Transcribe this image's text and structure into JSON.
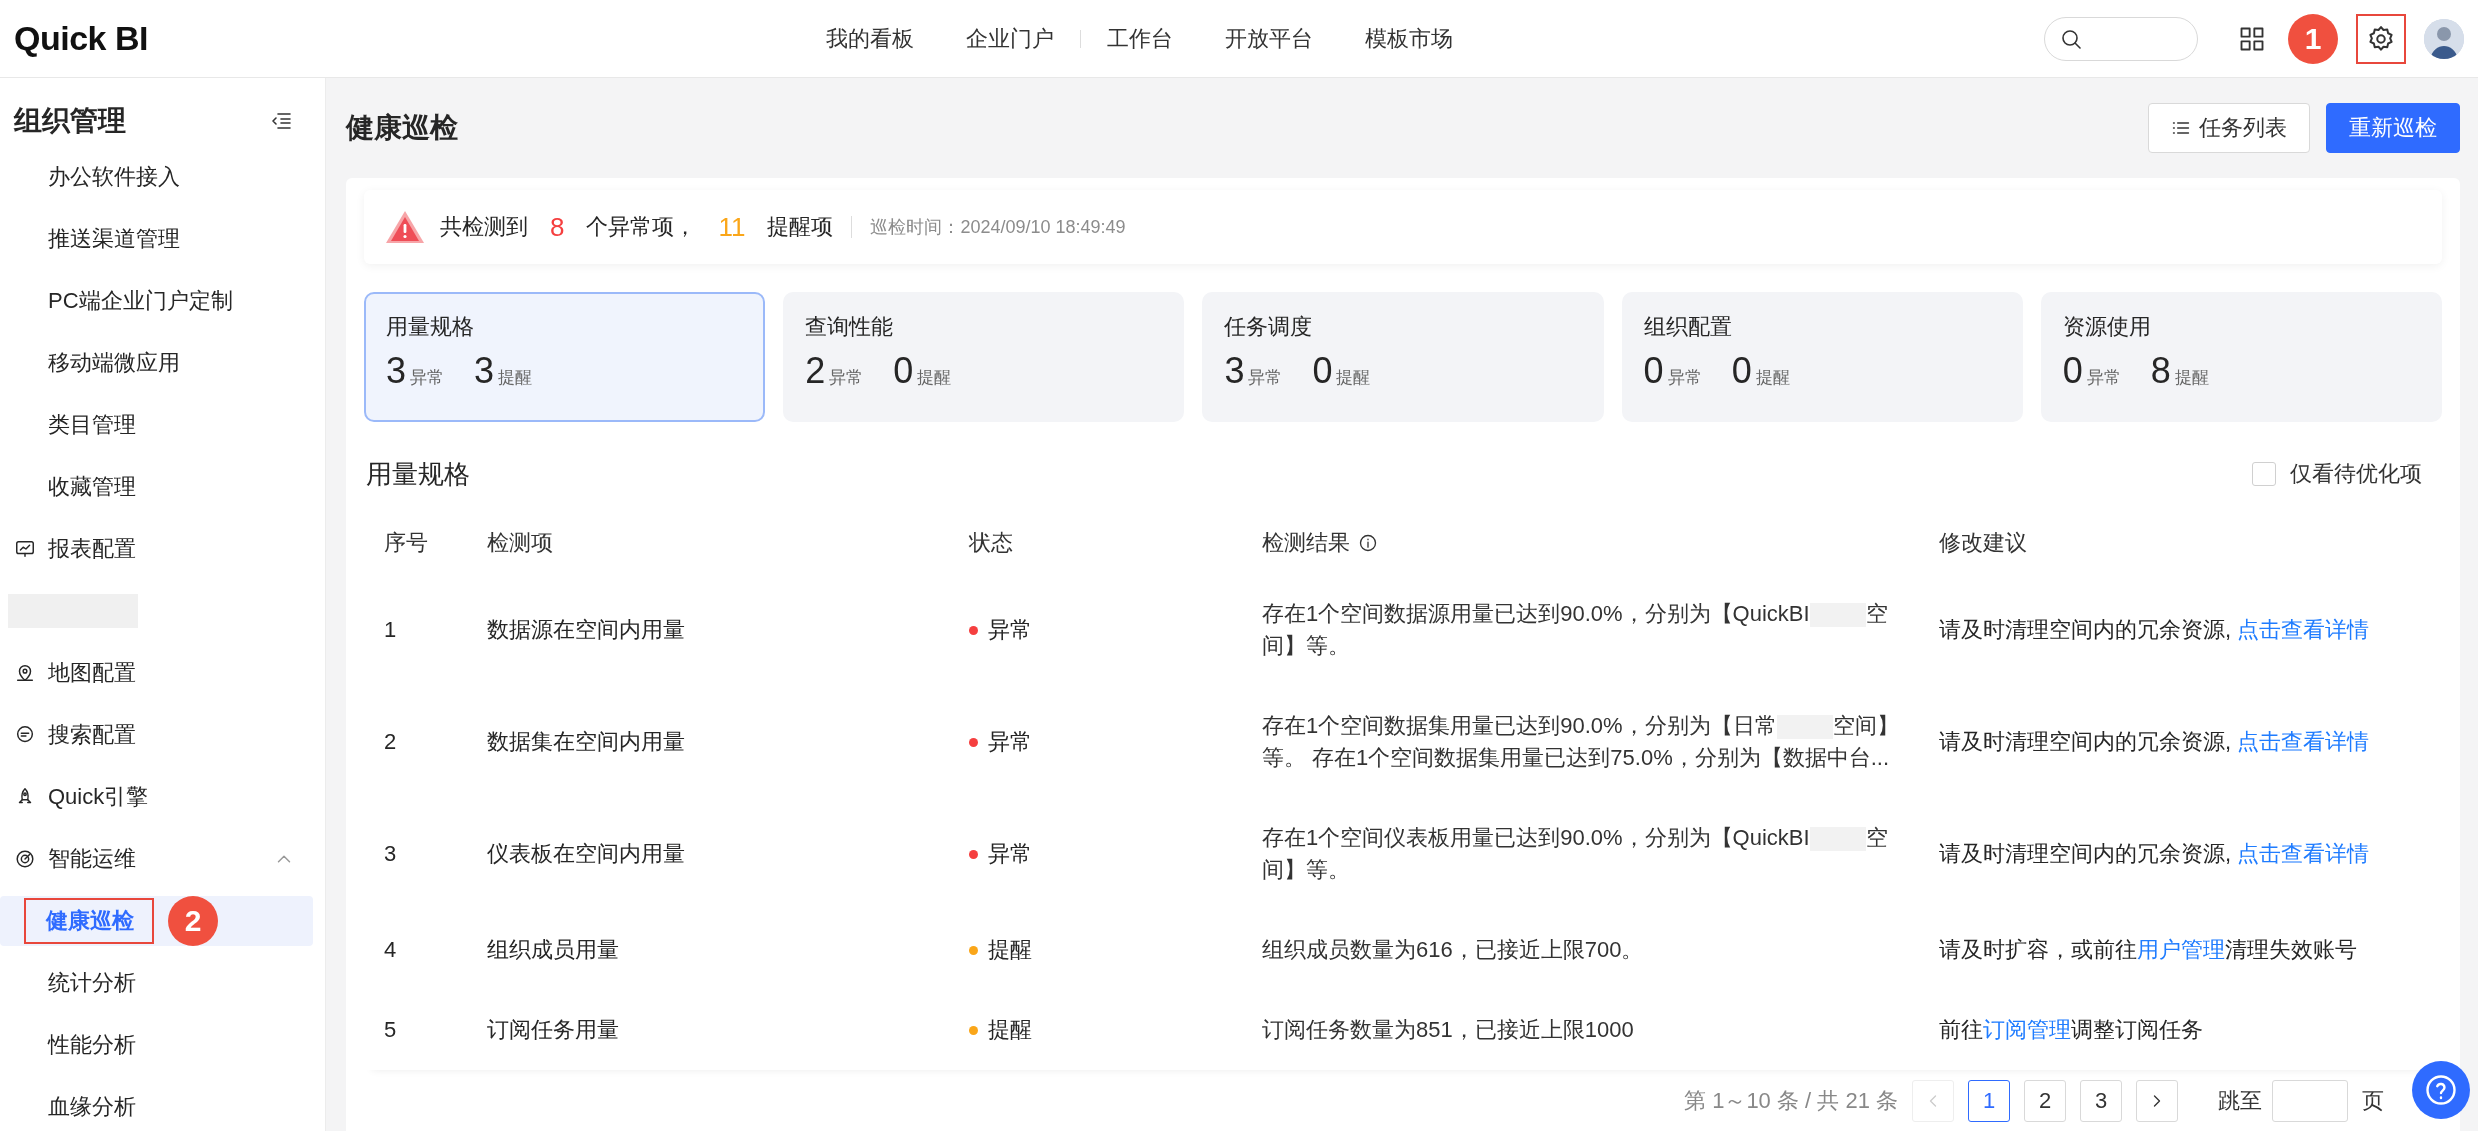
{
  "top_bar": {
    "logo": "Quick BI",
    "nav": [
      {
        "label": "我的看板"
      },
      {
        "label": "企业门户"
      },
      {
        "label": "工作台"
      },
      {
        "label": "开放平台"
      },
      {
        "label": "模板市场"
      }
    ],
    "settings_highlighted": true,
    "callout": "1"
  },
  "sidebar": {
    "sections": [
      {
        "kind": "header",
        "label": "组织管理",
        "children": [
          {
            "label": "办公软件接入",
            "selected": false,
            "highlighted": false
          },
          {
            "label": "推送渠道管理",
            "selected": false,
            "highlighted": false
          },
          {
            "label": "PC端企业门户定制",
            "selected": false,
            "highlighted": false
          },
          {
            "label": "移动端微应用",
            "selected": false,
            "highlighted": false
          },
          {
            "label": "类目管理",
            "selected": false,
            "highlighted": false
          },
          {
            "label": "收藏管理",
            "selected": false,
            "highlighted": false
          }
        ]
      },
      {
        "kind": "group",
        "label": "报表配置"
      },
      {
        "kind": "redacted"
      },
      {
        "kind": "group",
        "label": "地图配置"
      },
      {
        "kind": "group",
        "label": "搜索配置"
      },
      {
        "kind": "group",
        "label": "Quick引擎"
      },
      {
        "kind": "group",
        "label": "智能运维",
        "expanded": true,
        "children": [
          {
            "label": "健康巡检",
            "selected": true,
            "highlighted": true,
            "callout": "2"
          },
          {
            "label": "统计分析",
            "selected": false,
            "highlighted": false
          },
          {
            "label": "性能分析",
            "selected": false,
            "highlighted": false
          },
          {
            "label": "血缘分析",
            "selected": false,
            "highlighted": false
          }
        ]
      }
    ]
  },
  "page_header": {
    "title": "健康巡检",
    "buttons": [
      {
        "label": "任务列表",
        "kind": "secondary"
      },
      {
        "label": "重新巡检",
        "kind": "primary"
      }
    ]
  },
  "summary": {
    "prefix": "共检测到",
    "abnormal_count": "8",
    "abnormal_label": "个异常项，",
    "reminder_count": "11",
    "reminder_label": "提醒项",
    "time": "巡检时间：2024/09/10 18:49:49"
  },
  "categories": [
    {
      "title": "用量规格",
      "abnormal": "3",
      "abnormal_label": "异常",
      "reminder": "3",
      "reminder_label": "提醒",
      "selected": true
    },
    {
      "title": "查询性能",
      "abnormal": "2",
      "abnormal_label": "异常",
      "reminder": "0",
      "reminder_label": "提醒",
      "selected": false
    },
    {
      "title": "任务调度",
      "abnormal": "3",
      "abnormal_label": "异常",
      "reminder": "0",
      "reminder_label": "提醒",
      "selected": false
    },
    {
      "title": "组织配置",
      "abnormal": "0",
      "abnormal_label": "异常",
      "reminder": "0",
      "reminder_label": "提醒",
      "selected": false
    },
    {
      "title": "资源使用",
      "abnormal": "0",
      "abnormal_label": "异常",
      "reminder": "8",
      "reminder_label": "提醒",
      "selected": false
    }
  ],
  "section": {
    "title": "用量规格",
    "filter": {
      "label": "仅看待优化项",
      "checked": false
    }
  },
  "table": {
    "columns": [
      {
        "label": "序号",
        "kind": "plain"
      },
      {
        "label": "检测项",
        "kind": "plain"
      },
      {
        "label": "状态",
        "kind": "plain"
      },
      {
        "label": "检测结果",
        "kind": "with_info"
      },
      {
        "label": "修改建议",
        "kind": "plain"
      }
    ],
    "rows": [
      {
        "index": "1",
        "item": "数据源在空间内用量",
        "status": "异常",
        "color": "#f53f3f",
        "result": [
          {
            "kind": "text",
            "text": "存在1个空间数据源用量已达到90.0%，分别为【QuickBI"
          },
          {
            "kind": "redacted"
          },
          {
            "kind": "text",
            "text": "空间】等。"
          }
        ],
        "advice": [
          {
            "kind": "text",
            "text": "请及时清理空间内的冗余资源, "
          },
          {
            "kind": "link",
            "text": "点击查看详情"
          }
        ]
      },
      {
        "index": "2",
        "item": "数据集在空间内用量",
        "status": "异常",
        "color": "#f53f3f",
        "result": [
          {
            "kind": "text",
            "text": "存在1个空间数据集用量已达到90.0%，分别为【日常"
          },
          {
            "kind": "redacted"
          },
          {
            "kind": "text",
            "text": "空间】等。 存在1个空间数据集用量已达到75.0%，分别为【数据中台..."
          }
        ],
        "advice": [
          {
            "kind": "text",
            "text": "请及时清理空间内的冗余资源, "
          },
          {
            "kind": "link",
            "text": "点击查看详情"
          }
        ]
      },
      {
        "index": "3",
        "item": "仪表板在空间内用量",
        "status": "异常",
        "color": "#f53f3f",
        "result": [
          {
            "kind": "text",
            "text": "存在1个空间仪表板用量已达到90.0%，分别为【QuickBI"
          },
          {
            "kind": "redacted"
          },
          {
            "kind": "text",
            "text": "空间】等。"
          }
        ],
        "advice": [
          {
            "kind": "text",
            "text": "请及时清理空间内的冗余资源, "
          },
          {
            "kind": "link",
            "text": "点击查看详情"
          }
        ]
      },
      {
        "index": "4",
        "item": "组织成员用量",
        "status": "提醒",
        "color": "#faa619",
        "result": [
          {
            "kind": "text",
            "text": "组织成员数量为616，已接近上限700。"
          }
        ],
        "advice": [
          {
            "kind": "text",
            "text": "请及时扩容，或前往"
          },
          {
            "kind": "link",
            "text": "用户管理"
          },
          {
            "kind": "text",
            "text": "清理失效账号"
          }
        ]
      },
      {
        "index": "5",
        "item": "订阅任务用量",
        "status": "提醒",
        "color": "#faa619",
        "result": [
          {
            "kind": "text",
            "text": "订阅任务数量为851，已接近上限1000"
          }
        ],
        "advice": [
          {
            "kind": "text",
            "text": "前往"
          },
          {
            "kind": "link",
            "text": "订阅管理"
          },
          {
            "kind": "text",
            "text": "调整订阅任务"
          }
        ]
      }
    ]
  },
  "pagination": {
    "summary": "第 1～10 条 / 共 21 条",
    "prev_disabled": true,
    "next_disabled": false,
    "pages": [
      {
        "label": "1",
        "selected": true
      },
      {
        "label": "2",
        "selected": false
      },
      {
        "label": "3",
        "selected": false
      }
    ],
    "jump_label": "跳至",
    "page_suffix": "页"
  }
}
